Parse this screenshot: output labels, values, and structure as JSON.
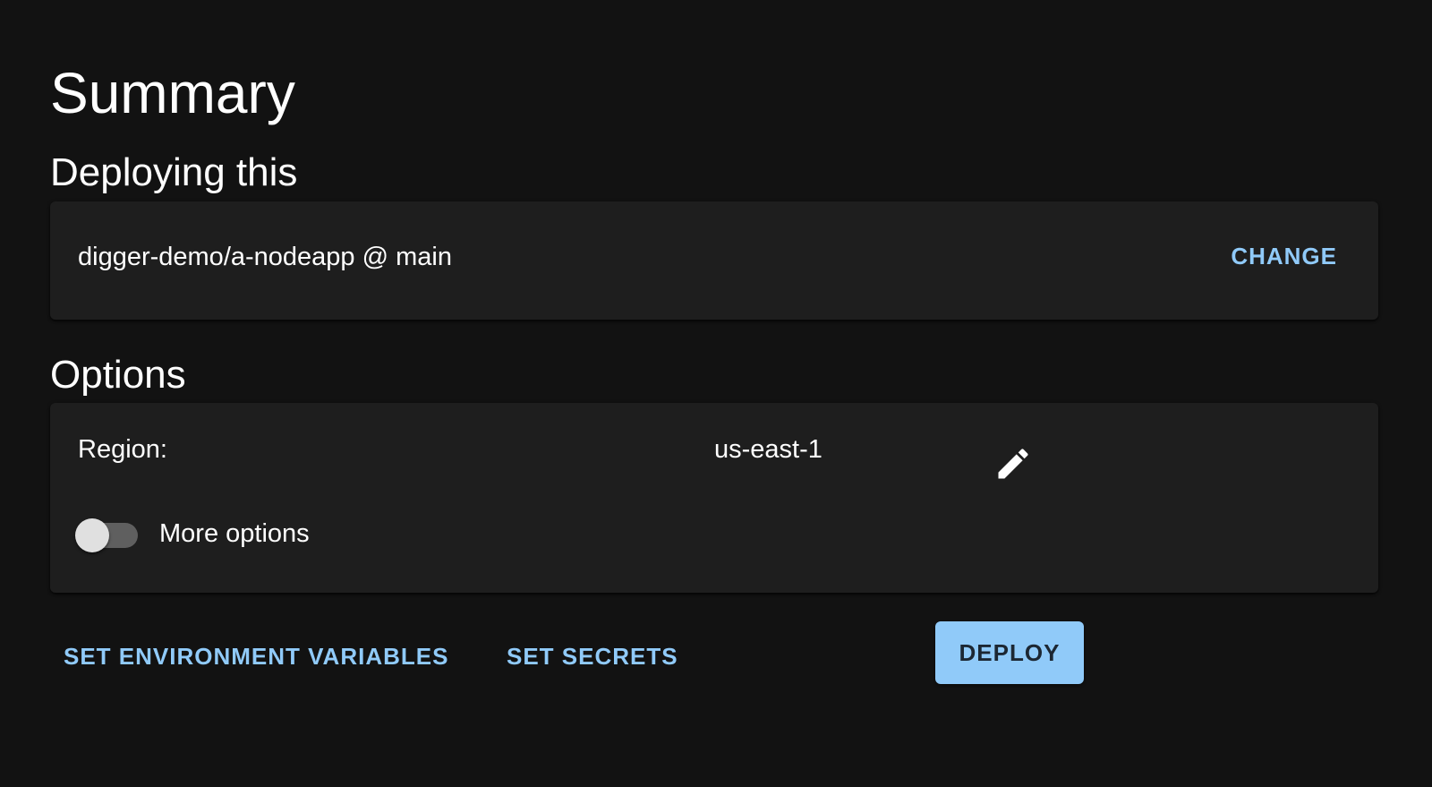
{
  "page": {
    "title": "Summary"
  },
  "deploying": {
    "heading": "Deploying this",
    "repo": "digger-demo/a-nodeapp @ main",
    "change_label": "CHANGE"
  },
  "options": {
    "heading": "Options",
    "region_label": "Region:",
    "region_value": "us-east-1",
    "edit_icon": "pencil-icon",
    "more_options_label": "More options",
    "more_options_enabled": false
  },
  "actions": {
    "env_vars_label": "SET ENVIRONMENT VARIABLES",
    "secrets_label": "SET SECRETS",
    "deploy_label": "DEPLOY"
  },
  "colors": {
    "background": "#121212",
    "card": "#1e1e1e",
    "accent": "#90caf9",
    "text": "#ffffff"
  }
}
